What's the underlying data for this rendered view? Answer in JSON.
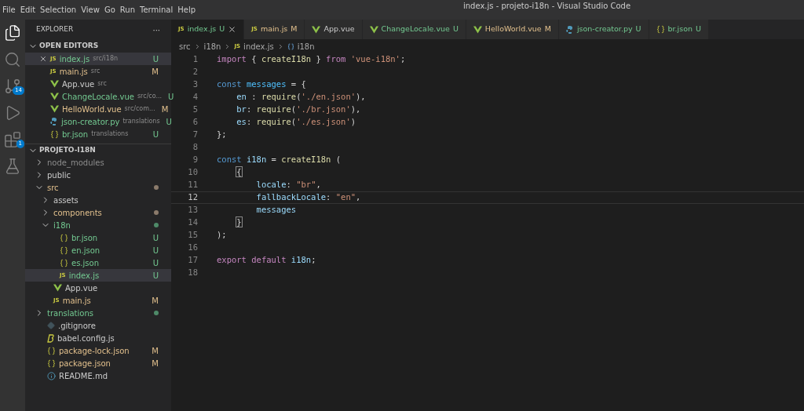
{
  "window": {
    "title": "index.js - projeto-i18n - Visual Studio Code"
  },
  "menu": [
    "File",
    "Edit",
    "Selection",
    "View",
    "Go",
    "Run",
    "Terminal",
    "Help"
  ],
  "activity_bar": [
    {
      "kind": "files",
      "selected": true
    },
    {
      "kind": "search",
      "selected": false
    },
    {
      "kind": "source-control",
      "selected": false,
      "badge": "14"
    },
    {
      "kind": "run",
      "selected": false
    },
    {
      "kind": "extensions",
      "selected": false,
      "badge": "1"
    },
    {
      "kind": "testing",
      "selected": false
    }
  ],
  "sidebar": {
    "title": "EXPLORER",
    "more": "···",
    "open_editors": {
      "title": "OPEN EDITORS",
      "expanded": true,
      "items": [
        {
          "name": "index.js",
          "path": "src/i18n",
          "kind": "js",
          "icon": "JS",
          "status": "U",
          "untracked": true,
          "modified": false,
          "selected": true
        },
        {
          "name": "main.js",
          "path": "src",
          "kind": "js",
          "icon": "JS",
          "status": "M",
          "untracked": false,
          "modified": true,
          "selected": false
        },
        {
          "name": "App.vue",
          "path": "src",
          "kind": "vue",
          "untracked": false,
          "modified": false,
          "selected": false
        },
        {
          "name": "ChangeLocale.vue",
          "path": "src/co...",
          "kind": "vue",
          "status": "U",
          "untracked": true,
          "modified": false,
          "selected": false
        },
        {
          "name": "HelloWorld.vue",
          "path": "src/com...",
          "kind": "vue",
          "status": "M",
          "untracked": false,
          "modified": true,
          "selected": false
        },
        {
          "name": "json-creator.py",
          "path": "translations",
          "kind": "py",
          "status": "U",
          "untracked": true,
          "modified": false,
          "selected": false
        },
        {
          "name": "br.json",
          "path": "translations",
          "kind": "json",
          "status": "U",
          "untracked": true,
          "modified": false,
          "selected": false
        }
      ]
    },
    "project": {
      "title": "PROJETO-I18N",
      "expanded": true,
      "items": [
        {
          "name": "node_modules",
          "kind": "folder",
          "expanded": false,
          "untracked": false,
          "modified": false,
          "ignored": true
        },
        {
          "name": "public",
          "kind": "folder",
          "expanded": false,
          "untracked": false,
          "modified": false,
          "ignored": false
        },
        {
          "name": "src",
          "kind": "folder",
          "expanded": true,
          "untracked": false,
          "modified": true,
          "ignored": false,
          "children": [
            {
              "name": "assets",
              "kind": "folder",
              "expanded": false,
              "untracked": false,
              "modified": false,
              "ignored": false
            },
            {
              "name": "components",
              "kind": "folder",
              "expanded": false,
              "untracked": false,
              "modified": true,
              "ignored": false
            },
            {
              "name": "i18n",
              "kind": "folder",
              "expanded": true,
              "untracked": true,
              "modified": false,
              "ignored": false,
              "children": [
                {
                  "name": "br.json",
                  "kind": "json",
                  "status": "U",
                  "untracked": true,
                  "modified": false,
                  "ignored": false,
                  "selected": false
                },
                {
                  "name": "en.json",
                  "kind": "json",
                  "status": "U",
                  "untracked": true,
                  "modified": false,
                  "ignored": false,
                  "selected": false
                },
                {
                  "name": "es.json",
                  "kind": "json",
                  "status": "U",
                  "untracked": true,
                  "modified": false,
                  "ignored": false,
                  "selected": false
                },
                {
                  "name": "index.js",
                  "kind": "js",
                  "icon": "JS",
                  "status": "U",
                  "untracked": true,
                  "modified": false,
                  "ignored": false,
                  "selected": true
                }
              ]
            },
            {
              "name": "App.vue",
              "kind": "vue",
              "untracked": false,
              "modified": false,
              "ignored": false,
              "selected": false
            },
            {
              "name": "main.js",
              "kind": "js",
              "icon": "JS",
              "status": "M",
              "untracked": false,
              "modified": true,
              "ignored": false,
              "selected": false
            }
          ]
        },
        {
          "name": "translations",
          "kind": "folder",
          "expanded": false,
          "untracked": true,
          "modified": false,
          "ignored": false
        },
        {
          "name": ".gitignore",
          "kind": "git",
          "untracked": false,
          "modified": false,
          "ignored": false,
          "selected": false
        },
        {
          "name": "babel.config.js",
          "kind": "babel",
          "untracked": false,
          "modified": false,
          "ignored": false,
          "selected": false
        },
        {
          "name": "package-lock.json",
          "kind": "json",
          "status": "M",
          "untracked": false,
          "modified": true,
          "ignored": false,
          "selected": false
        },
        {
          "name": "package.json",
          "kind": "json",
          "status": "M",
          "untracked": false,
          "modified": true,
          "ignored": false,
          "selected": false
        },
        {
          "name": "README.md",
          "kind": "info",
          "untracked": false,
          "modified": false,
          "ignored": false,
          "selected": false
        }
      ]
    }
  },
  "tabs": [
    {
      "label": "index.js",
      "kind": "js",
      "icon": "JS",
      "status": "U",
      "untracked": true,
      "modified": false,
      "selected": true
    },
    {
      "label": "main.js",
      "kind": "js",
      "icon": "JS",
      "status": "M",
      "untracked": false,
      "modified": true,
      "selected": false
    },
    {
      "label": "App.vue",
      "kind": "vue",
      "untracked": false,
      "modified": false,
      "selected": false
    },
    {
      "label": "ChangeLocale.vue",
      "kind": "vue",
      "status": "U",
      "untracked": true,
      "modified": false,
      "selected": false
    },
    {
      "label": "HelloWorld.vue",
      "kind": "vue",
      "status": "M",
      "untracked": false,
      "modified": true,
      "selected": false
    },
    {
      "label": "json-creator.py",
      "kind": "py",
      "status": "U",
      "untracked": true,
      "modified": false,
      "selected": false
    },
    {
      "label": "br.json",
      "kind": "json",
      "status": "U",
      "untracked": true,
      "modified": false,
      "selected": false
    }
  ],
  "breadcrumb": [
    {
      "label": "src"
    },
    {
      "label": "i18n"
    },
    {
      "label": "index.js",
      "kind": "js",
      "icon": "JS"
    },
    {
      "label": "i18n",
      "kind": "symbol"
    }
  ],
  "editor": {
    "lines": [
      {
        "number": "1",
        "current": false,
        "tokens": [
          {
            "kind": "kw",
            "t": "import"
          },
          {
            "kind": "p",
            "t": " { "
          },
          {
            "kind": "fn",
            "t": "createI18n"
          },
          {
            "kind": "p",
            "t": " } "
          },
          {
            "kind": "kw",
            "t": "from"
          },
          {
            "kind": "str",
            "t": " 'vue-i18n'"
          },
          {
            "kind": "p",
            "t": ";"
          }
        ]
      },
      {
        "number": "2",
        "current": false
      },
      {
        "number": "3",
        "current": false,
        "tokens": [
          {
            "kind": "decl",
            "t": "const"
          },
          {
            "kind": "const",
            "t": " messages"
          },
          {
            "kind": "p",
            "t": " = {"
          }
        ]
      },
      {
        "number": "4",
        "current": false,
        "tokens": [
          {
            "kind": "var",
            "t": "    en"
          },
          {
            "kind": "p",
            "t": " : "
          },
          {
            "kind": "fn",
            "t": "require"
          },
          {
            "kind": "p",
            "t": "("
          },
          {
            "kind": "str",
            "t": "'./en.json'"
          },
          {
            "kind": "p",
            "t": "),"
          }
        ]
      },
      {
        "number": "5",
        "current": false,
        "tokens": [
          {
            "kind": "var",
            "t": "    br"
          },
          {
            "kind": "p",
            "t": ": "
          },
          {
            "kind": "fn",
            "t": "require"
          },
          {
            "kind": "p",
            "t": "("
          },
          {
            "kind": "str",
            "t": "'./br.json'"
          },
          {
            "kind": "p",
            "t": "),"
          }
        ]
      },
      {
        "number": "6",
        "current": false,
        "tokens": [
          {
            "kind": "var",
            "t": "    es"
          },
          {
            "kind": "p",
            "t": ": "
          },
          {
            "kind": "fn",
            "t": "require"
          },
          {
            "kind": "p",
            "t": "("
          },
          {
            "kind": "str",
            "t": "'./es.json'"
          },
          {
            "kind": "p",
            "t": ")"
          }
        ]
      },
      {
        "number": "7",
        "current": false,
        "tokens": [
          {
            "kind": "p",
            "t": "};"
          }
        ]
      },
      {
        "number": "8",
        "current": false
      },
      {
        "number": "9",
        "current": false,
        "tokens": [
          {
            "kind": "decl",
            "t": "const"
          },
          {
            "kind": "var",
            "t": " i18n"
          },
          {
            "kind": "p",
            "t": " = "
          },
          {
            "kind": "fn",
            "t": "createI18n"
          },
          {
            "kind": "p",
            "t": " ("
          }
        ]
      },
      {
        "number": "10",
        "current": false,
        "tokens": [
          {
            "kind": "bm",
            "t": "    {"
          }
        ]
      },
      {
        "number": "11",
        "current": false,
        "tokens": [
          {
            "kind": "var",
            "t": "        locale"
          },
          {
            "kind": "p",
            "t": ": "
          },
          {
            "kind": "str",
            "t": "\"br\""
          },
          {
            "kind": "p",
            "t": ","
          }
        ]
      },
      {
        "number": "12",
        "current": true,
        "tokens": [
          {
            "kind": "var",
            "t": "        fallbackLocale"
          },
          {
            "kind": "p",
            "t": ": "
          },
          {
            "kind": "str",
            "t": "\"en\""
          },
          {
            "kind": "p",
            "t": ","
          }
        ]
      },
      {
        "number": "13",
        "current": false,
        "tokens": [
          {
            "kind": "var",
            "t": "        messages"
          }
        ]
      },
      {
        "number": "14",
        "current": false,
        "tokens": [
          {
            "kind": "bm",
            "t": "    }"
          }
        ]
      },
      {
        "number": "15",
        "current": false,
        "tokens": [
          {
            "kind": "p",
            "t": ");"
          }
        ]
      },
      {
        "number": "16",
        "current": false
      },
      {
        "number": "17",
        "current": false,
        "tokens": [
          {
            "kind": "kw",
            "t": "export"
          },
          {
            "kind": "kw",
            "t": " default"
          },
          {
            "kind": "var",
            "t": " i18n"
          },
          {
            "kind": "p",
            "t": ";"
          }
        ]
      },
      {
        "number": "18",
        "current": false
      }
    ]
  }
}
